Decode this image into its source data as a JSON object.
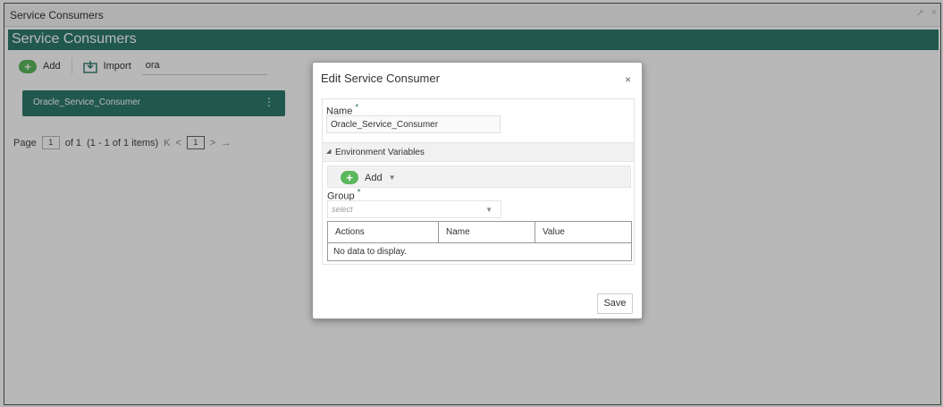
{
  "window": {
    "title": "Service Consumers",
    "controls": [
      "↗",
      "×"
    ]
  },
  "banner": {
    "title": "Service Consumers"
  },
  "toolbar": {
    "add_label": "Add",
    "import_label": "Import",
    "search_value": "ora"
  },
  "list": {
    "items": [
      {
        "label": "Oracle_Service_Consumer"
      }
    ]
  },
  "pager": {
    "page_label": "Page",
    "page_value": "1",
    "of_label": "of 1",
    "items_label": "(1 - 1 of 1 items)",
    "first": "K",
    "prev": "<",
    "current": "1",
    "next": ">",
    "last": "→"
  },
  "modal": {
    "title": "Edit Service Consumer",
    "close": "×",
    "name_label": "Name",
    "required_mark": "*",
    "name_value": "Oracle_Service_Consumer",
    "env_section": "Environment Variables",
    "env_toggle": "◢",
    "add_label": "Add",
    "add_caret": "▼",
    "group_label": "Group",
    "group_placeholder": "select",
    "group_caret": "▼",
    "table": {
      "headers": [
        "Actions",
        "Name",
        "Value"
      ],
      "empty_message": "No data to display."
    },
    "save_label": "Save"
  },
  "colors": {
    "brand": "#2e7a6d",
    "add_green": "#5cb85c"
  }
}
